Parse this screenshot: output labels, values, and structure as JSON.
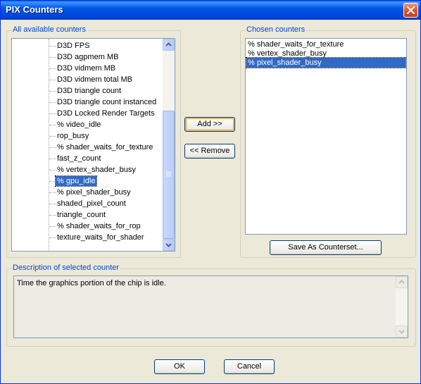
{
  "window": {
    "title": "PIX Counters"
  },
  "available": {
    "label": "All available counters",
    "items": [
      "D3D FPS",
      "D3D agpmem MB",
      "D3D vidmem MB",
      "D3D vidmem total MB",
      "D3D triangle count",
      "D3D triangle count instanced",
      "D3D Locked Render Targets",
      "% video_idle",
      "rop_busy",
      "% shader_waits_for_texture",
      "fast_z_count",
      "% vertex_shader_busy",
      "% gpu_idle",
      "% pixel_shader_busy",
      "shaded_pixel_count",
      "triangle_count",
      "% shader_waits_for_rop",
      "texture_waits_for_shader"
    ],
    "selected_index": 12
  },
  "chosen": {
    "label": "Chosen counters",
    "items": [
      "% shader_waits_for_texture",
      "% vertex_shader_busy",
      "% pixel_shader_busy"
    ],
    "selected_index": 2
  },
  "buttons": {
    "add": "Add >>",
    "remove": "<< Remove",
    "save": "Save As Counterset...",
    "ok": "OK",
    "cancel": "Cancel"
  },
  "description": {
    "label": "Description of selected counter",
    "text": "Time the graphics portion of the chip is idle."
  },
  "icons": {
    "close": "close-icon",
    "scroll_up": "scroll-up-arrow-icon",
    "scroll_down": "scroll-down-arrow-icon"
  },
  "colors": {
    "title_bar": "#0054e3",
    "selection": "#316ac5",
    "group_label": "#0046d5",
    "dialog_bg": "#ece9d8"
  }
}
